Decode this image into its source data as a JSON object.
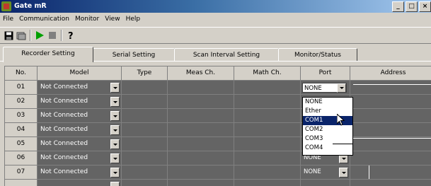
{
  "window": {
    "title": "Gate mR",
    "buttons": {
      "minimize": "_",
      "maximize": "□",
      "close": "×"
    }
  },
  "menu": {
    "items": [
      "File",
      "Communication",
      "Monitor",
      "View",
      "Help"
    ]
  },
  "toolbar": {
    "icons": [
      "save-icon",
      "open-icon",
      "play-icon",
      "stop-icon",
      "help-icon"
    ],
    "colors": {
      "play": "#00a000",
      "stop": "#808080"
    }
  },
  "tabs": [
    {
      "label": "Recorder Setting",
      "active": true
    },
    {
      "label": "Serial Setting",
      "active": false
    },
    {
      "label": "Scan Interval Setting",
      "active": false
    },
    {
      "label": "Monitor/Status",
      "active": false
    }
  ],
  "table": {
    "headers": [
      "No.",
      "Model",
      "Type",
      "Meas Ch.",
      "Math Ch.",
      "Port",
      "Address"
    ],
    "rows": [
      {
        "no": "01",
        "model": "Not Connected",
        "port": "NONE"
      },
      {
        "no": "02",
        "model": "Not Connected",
        "port": ""
      },
      {
        "no": "03",
        "model": "Not Connected",
        "port": ""
      },
      {
        "no": "04",
        "model": "Not Connected",
        "port": ""
      },
      {
        "no": "05",
        "model": "Not Connected",
        "port": ""
      },
      {
        "no": "06",
        "model": "Not Connected",
        "port": "NONE"
      },
      {
        "no": "07",
        "model": "Not Connected",
        "port": "NONE"
      },
      {
        "no": "",
        "model": "",
        "port": ""
      }
    ]
  },
  "port_dropdown": {
    "options": [
      "NONE",
      "Ether",
      "COM1",
      "COM2",
      "COM3",
      "COM4"
    ],
    "selected": "COM1"
  },
  "colors": {
    "title_bar": "#0a246a",
    "cell_dark": "#646464",
    "selection": "#0a246a",
    "face": "#d4d0c8"
  }
}
